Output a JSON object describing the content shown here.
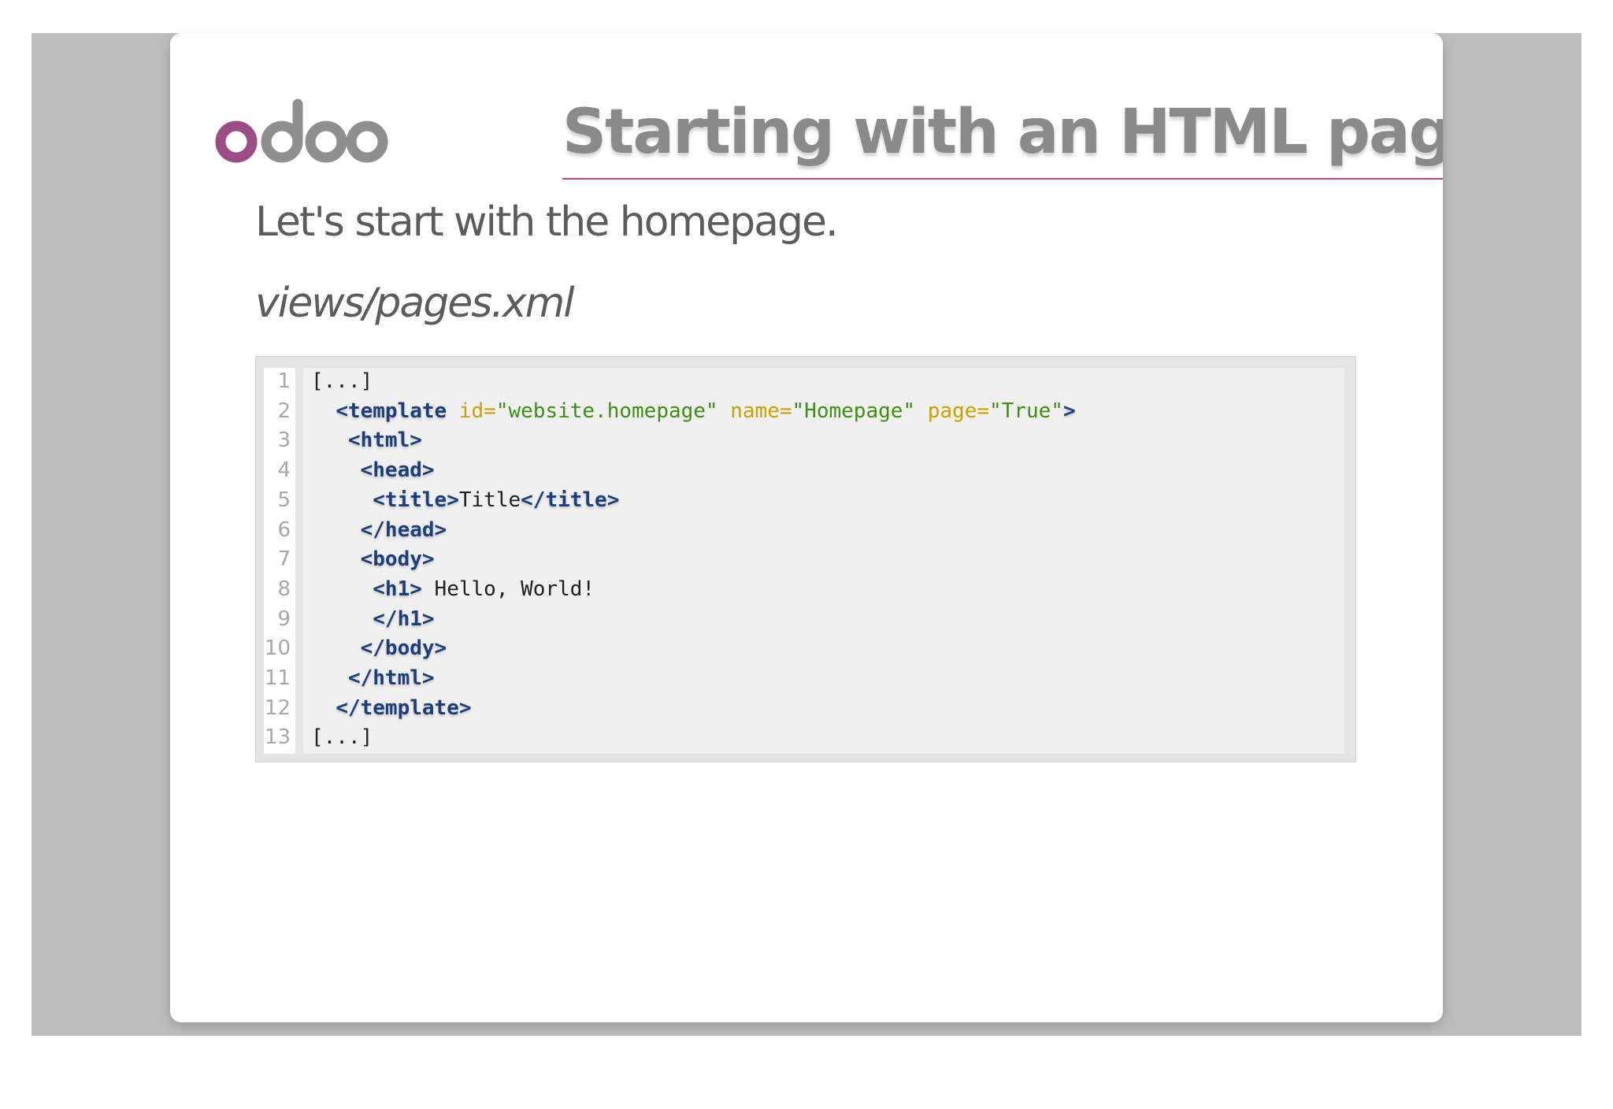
{
  "slide": {
    "title": "Starting with an HTML page",
    "intro": "Let's start with the homepage.",
    "filename": "views/pages.xml",
    "brand_color": "#9c4d86",
    "logo_color": "#8f8f8f"
  },
  "code": {
    "lines": [
      {
        "num": "1",
        "indent": "",
        "segments": [
          {
            "t": "[...]",
            "k": "plain"
          }
        ]
      },
      {
        "num": "2",
        "indent": "  ",
        "segments": [
          {
            "t": "<template",
            "k": "tag"
          },
          {
            "t": " ",
            "k": "plain"
          },
          {
            "t": "id=",
            "k": "attr"
          },
          {
            "t": "\"website.homepage\"",
            "k": "val"
          },
          {
            "t": " ",
            "k": "plain"
          },
          {
            "t": "name=",
            "k": "attr"
          },
          {
            "t": "\"Homepage\"",
            "k": "val"
          },
          {
            "t": " ",
            "k": "plain"
          },
          {
            "t": "page=",
            "k": "attr"
          },
          {
            "t": "\"True\"",
            "k": "val"
          },
          {
            "t": ">",
            "k": "tag"
          }
        ]
      },
      {
        "num": "3",
        "indent": "   ",
        "segments": [
          {
            "t": "<html>",
            "k": "tag"
          }
        ]
      },
      {
        "num": "4",
        "indent": "    ",
        "segments": [
          {
            "t": "<head>",
            "k": "tag"
          }
        ]
      },
      {
        "num": "5",
        "indent": "     ",
        "segments": [
          {
            "t": "<title>",
            "k": "tag"
          },
          {
            "t": "Title",
            "k": "plain"
          },
          {
            "t": "</title>",
            "k": "tag"
          }
        ]
      },
      {
        "num": "6",
        "indent": "    ",
        "segments": [
          {
            "t": "</head>",
            "k": "tag"
          }
        ]
      },
      {
        "num": "7",
        "indent": "    ",
        "segments": [
          {
            "t": "<body>",
            "k": "tag"
          }
        ]
      },
      {
        "num": "8",
        "indent": "     ",
        "segments": [
          {
            "t": "<h1>",
            "k": "tag"
          },
          {
            "t": " Hello, World!",
            "k": "plain"
          }
        ]
      },
      {
        "num": "9",
        "indent": "     ",
        "segments": [
          {
            "t": "</h1>",
            "k": "tag"
          }
        ]
      },
      {
        "num": "10",
        "indent": "    ",
        "segments": [
          {
            "t": "</body>",
            "k": "tag"
          }
        ]
      },
      {
        "num": "11",
        "indent": "   ",
        "segments": [
          {
            "t": "</html>",
            "k": "tag"
          }
        ]
      },
      {
        "num": "12",
        "indent": "  ",
        "segments": [
          {
            "t": "</template>",
            "k": "tag"
          }
        ]
      },
      {
        "num": "13",
        "indent": "",
        "segments": [
          {
            "t": "[...]",
            "k": "plain"
          }
        ]
      }
    ]
  }
}
